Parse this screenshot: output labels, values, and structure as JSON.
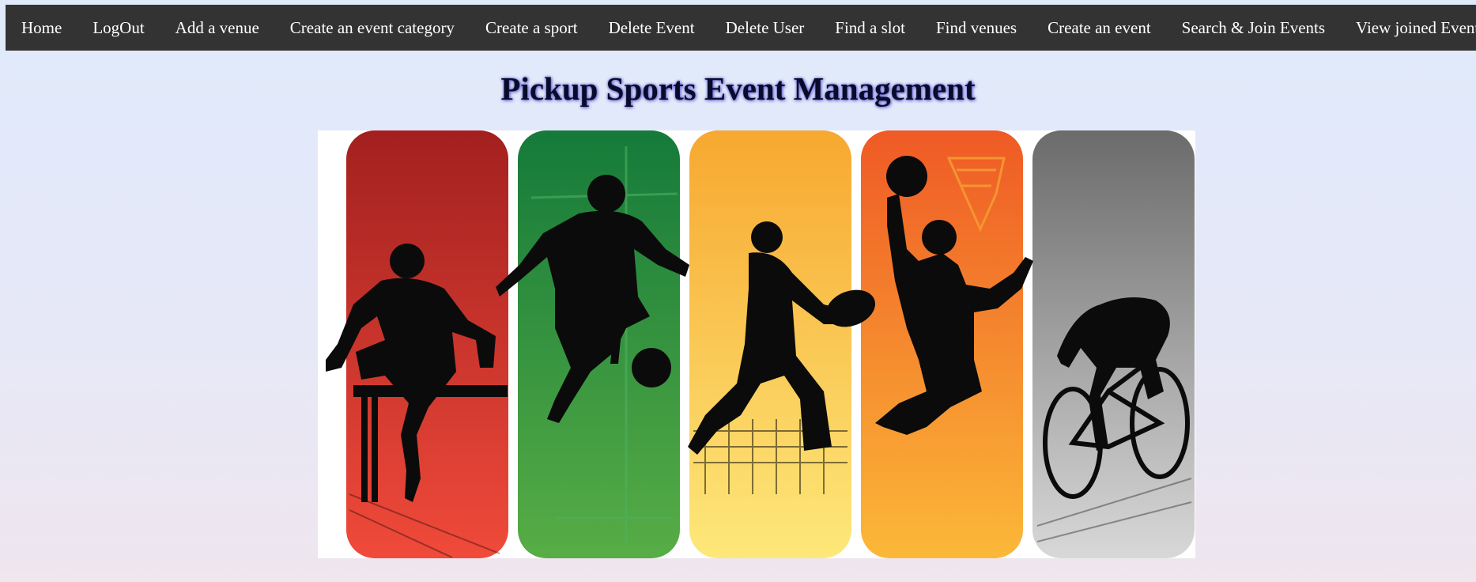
{
  "nav": {
    "items": [
      {
        "label": "Home"
      },
      {
        "label": "LogOut"
      },
      {
        "label": "Add a venue"
      },
      {
        "label": "Create an event category"
      },
      {
        "label": "Create a sport"
      },
      {
        "label": "Delete Event"
      },
      {
        "label": "Delete User"
      },
      {
        "label": "Find a slot"
      },
      {
        "label": "Find venues"
      },
      {
        "label": "Create an event"
      },
      {
        "label": "Search & Join Events"
      },
      {
        "label": "View joined Events"
      }
    ]
  },
  "page": {
    "title": "Pickup Sports Event Management"
  },
  "banner": {
    "panels": [
      {
        "sport": "hurdles",
        "color_top": "#a3201f",
        "color_bottom": "#f04a3a"
      },
      {
        "sport": "soccer",
        "color_top": "#157a3a",
        "color_bottom": "#57ad45"
      },
      {
        "sport": "american-football",
        "color_top": "#f7a830",
        "color_bottom": "#fde87a"
      },
      {
        "sport": "basketball",
        "color_top": "#ef5a25",
        "color_bottom": "#fbb838"
      },
      {
        "sport": "cycling",
        "color_top": "#6b6b6b",
        "color_bottom": "#d8d8d8"
      }
    ]
  }
}
